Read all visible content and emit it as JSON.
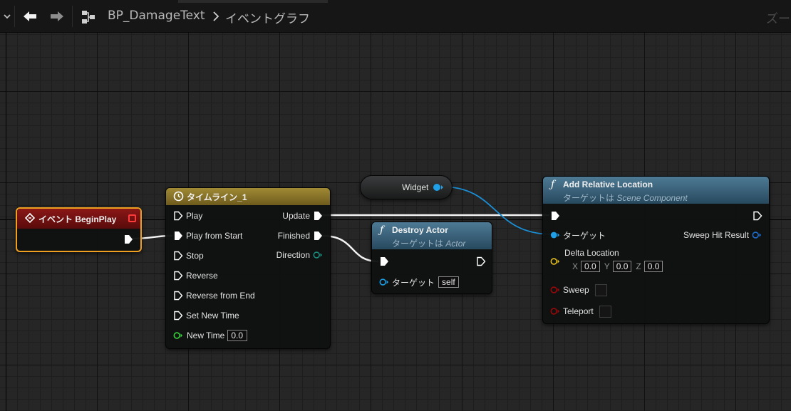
{
  "topbar": {
    "asset_name": "BP_DamageText",
    "graph_name": "イベントグラフ",
    "zoom_label": "ズー"
  },
  "nodes": {
    "begin_play": {
      "title": "イベント BeginPlay",
      "header_color": "#7a1212",
      "outline_color": "#f0a020"
    },
    "timeline": {
      "title": "タイムライン_1",
      "header_color": "#8c7629",
      "inputs": [
        "Play",
        "Play from Start",
        "Stop",
        "Reverse",
        "Reverse from End",
        "Set New Time"
      ],
      "new_time_label": "New Time",
      "new_time_value": "0.0",
      "outputs": {
        "update": "Update",
        "finished": "Finished",
        "direction": "Direction"
      }
    },
    "widget_getter": {
      "label": "Widget"
    },
    "destroy_actor": {
      "title": "Destroy Actor",
      "subtitle_prefix": "ターゲットは",
      "subtitle_class": "Actor",
      "target_label": "ターゲット",
      "target_value": "self"
    },
    "add_relative_location": {
      "title": "Add Relative Location",
      "subtitle_prefix": "ターゲットは",
      "subtitle_class": "Scene Component",
      "target_label": "ターゲット",
      "sweep_hit_result_label": "Sweep Hit Result",
      "delta_location_label": "Delta Location",
      "delta": {
        "x_label": "X",
        "x_value": "0.0",
        "y_label": "Y",
        "y_value": "0.0",
        "z_label": "Z",
        "z_value": "0.0"
      },
      "sweep_label": "Sweep",
      "teleport_label": "Teleport"
    }
  },
  "colors": {
    "exec_pin": "#ffffff",
    "object_pin": "#1fa0e8",
    "vector_pin": "#e8c21e",
    "bool_pin": "#8c0000",
    "float_pin": "#38d43a",
    "timeline_direction_pin": "#1c6e66",
    "wire_exec": "#f2f2f2",
    "wire_object": "#1a8fd6"
  },
  "icons": {
    "back": "arrow-left-icon",
    "forward": "arrow-right-icon",
    "blueprint": "blueprint-graph-icon",
    "function": "function-f-icon",
    "event": "event-diamond-icon",
    "timeline": "clock-icon"
  }
}
